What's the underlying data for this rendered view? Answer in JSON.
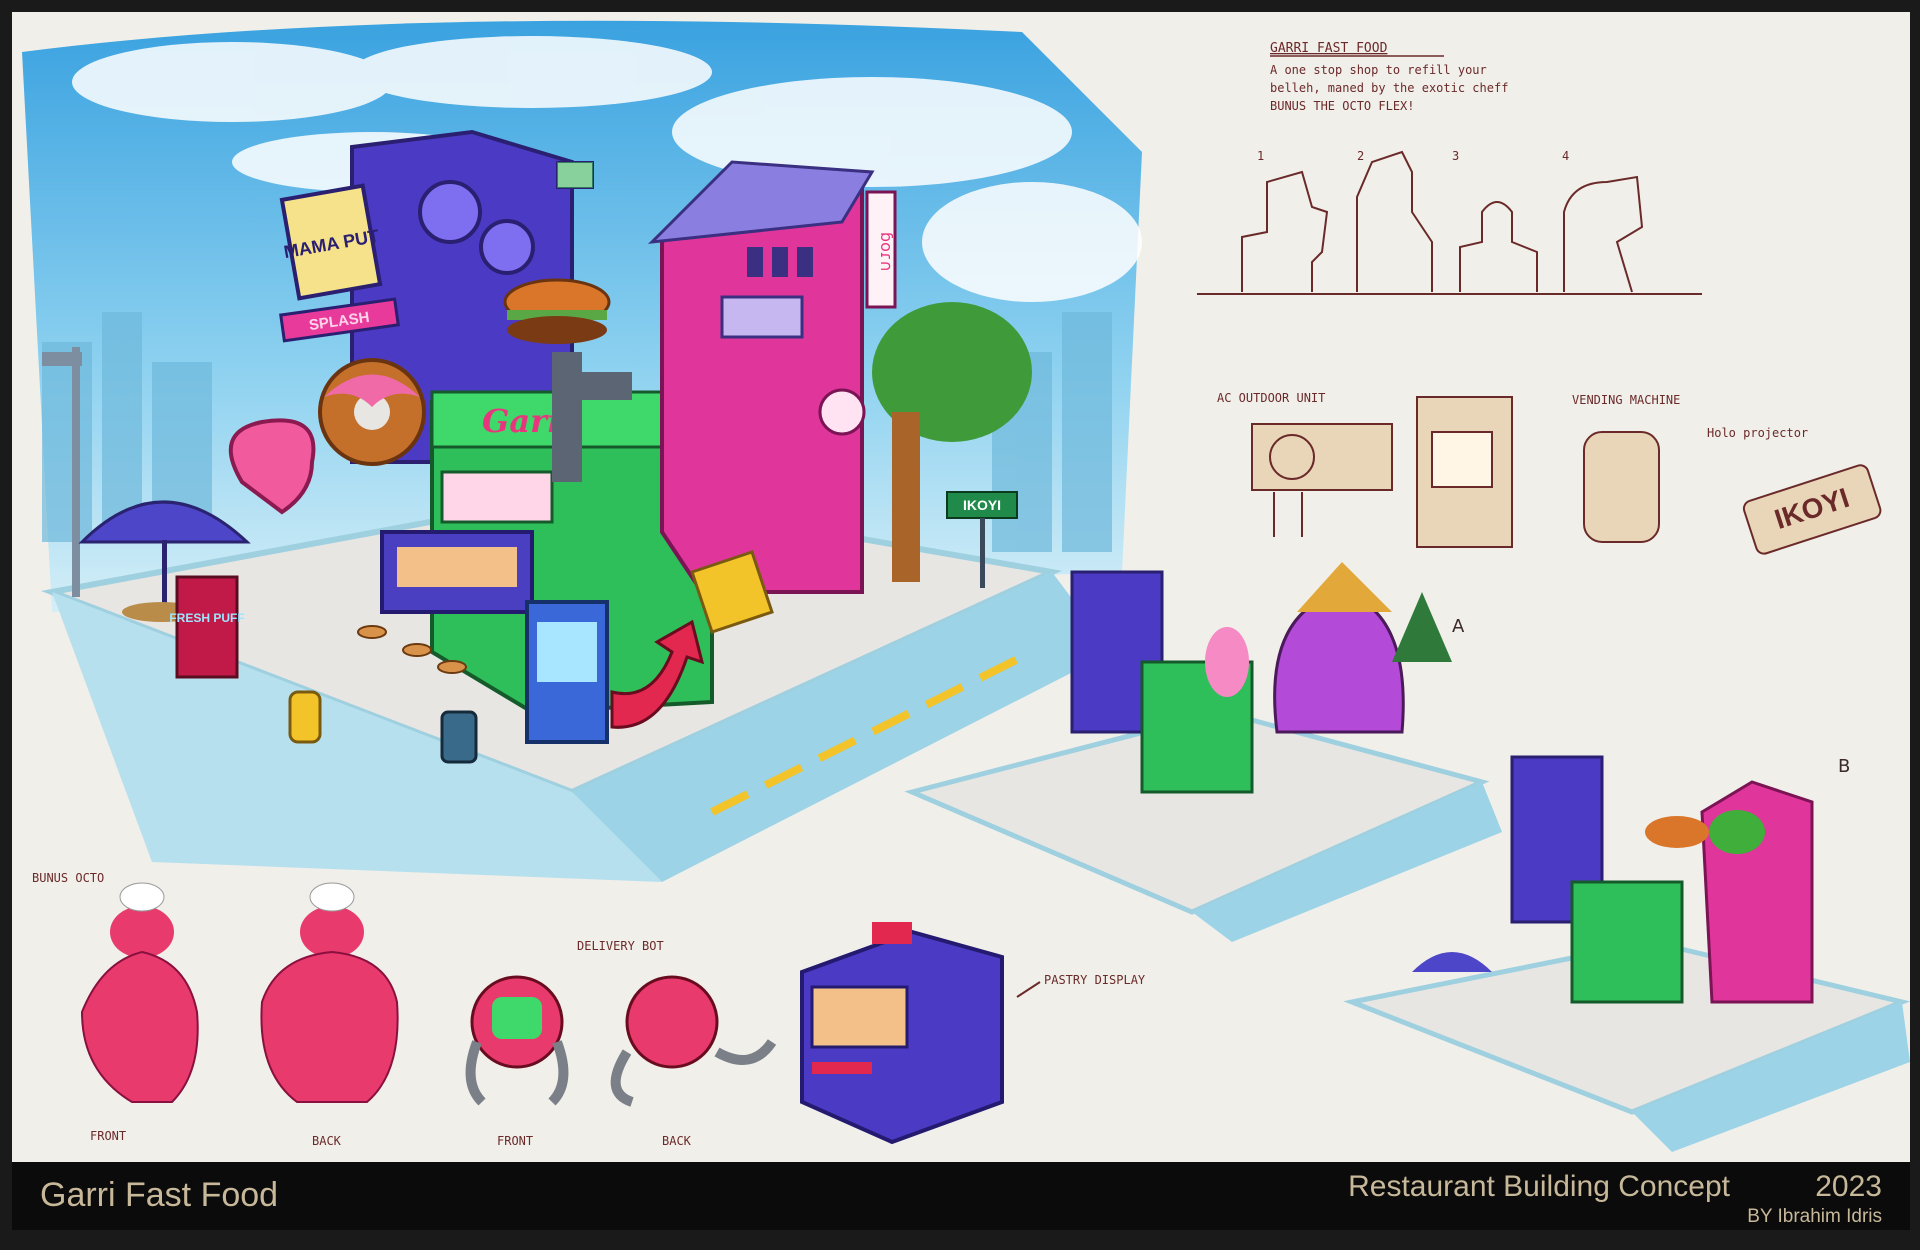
{
  "footer": {
    "title": "Garri Fast Food",
    "subtitle": "Restaurant Building Concept",
    "year": "2023",
    "credit": "BY Ibrahim Idris"
  },
  "notes": {
    "title": "GARRI FAST FOOD",
    "line1": "A one stop shop to refill your",
    "line2": "belleh, maned by the exotic cheff",
    "line3": "BUNUS THE OCTO FLEX!",
    "thumb_numbers": [
      "1",
      "2",
      "3",
      "4"
    ]
  },
  "props": {
    "ac_label": "AC OUTDOOR UNIT",
    "vending_label": "VENDING MACHINE",
    "holo_label": "Holo projector",
    "street_sign": "IKOYI"
  },
  "main_scene": {
    "mama_put_sign": "MAMA PUT",
    "splash_sign": "SPLASH",
    "garri_sign": "Garri",
    "fresh_puff_sign": "FRESH PUFF",
    "ikoyi_sign": "IKOYI",
    "wall_sign": "ɓoɾ∩"
  },
  "variants": {
    "label_a": "A",
    "label_b": "B"
  },
  "characters": {
    "octo_title": "BUNUS OCTO",
    "octo_front": "FRONT",
    "octo_back": "BACK",
    "bot_title": "DELIVERY BOT",
    "bot_front": "FRONT",
    "bot_back": "BACK",
    "pastry_label": "PASTRY DISPLAY"
  },
  "colors": {
    "sky": "#5bb6e6",
    "purple": "#4b3bc4",
    "pink": "#e0359a",
    "green": "#2fbf5a",
    "octo": "#e83a6c",
    "sketch": "#6b2a2a"
  }
}
